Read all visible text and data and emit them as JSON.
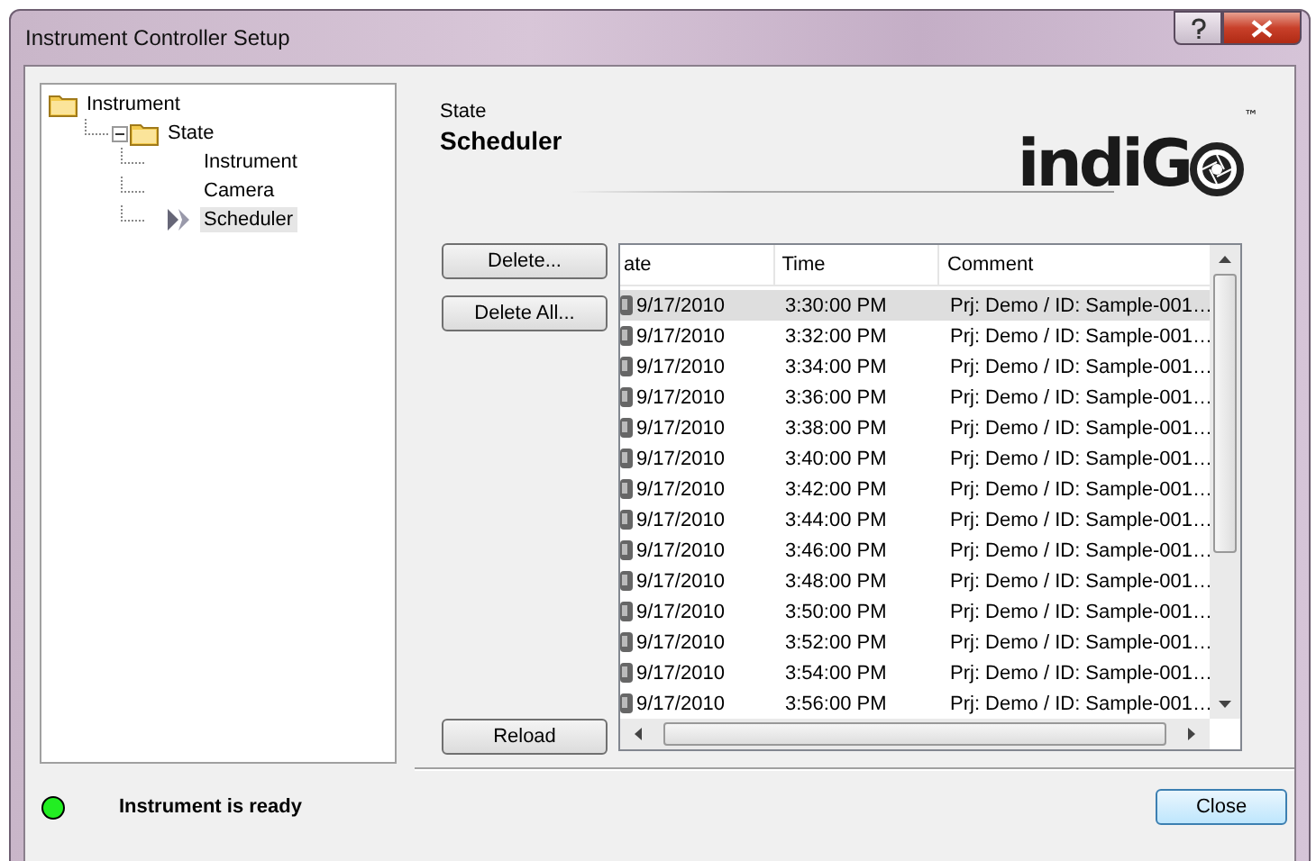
{
  "window": {
    "title": "Instrument Controller Setup"
  },
  "tree": [
    {
      "label": "Instrument",
      "kind": "folder",
      "selected": false,
      "children": [
        {
          "label": "State",
          "kind": "folder",
          "expanded": true,
          "selected": false,
          "children": [
            {
              "label": "Instrument",
              "kind": "leaf",
              "selected": false
            },
            {
              "label": "Camera",
              "kind": "leaf",
              "selected": false
            },
            {
              "label": "Scheduler",
              "kind": "leaf",
              "selected": true
            }
          ]
        }
      ]
    }
  ],
  "header": {
    "category": "State",
    "title": "Scheduler"
  },
  "logo": {
    "text": "indiG",
    "mark": "™"
  },
  "buttons": {
    "delete": "Delete...",
    "delete_all": "Delete All...",
    "reload": "Reload"
  },
  "table": {
    "columns": [
      "ate",
      "Time",
      "Comment"
    ],
    "rows": [
      {
        "date": "9/17/2010",
        "time": "3:30:00 PM",
        "comment": "Prj: Demo / ID: Sample-001…",
        "selected": true
      },
      {
        "date": "9/17/2010",
        "time": "3:32:00 PM",
        "comment": "Prj: Demo / ID: Sample-001…",
        "selected": false
      },
      {
        "date": "9/17/2010",
        "time": "3:34:00 PM",
        "comment": "Prj: Demo / ID: Sample-001…",
        "selected": false
      },
      {
        "date": "9/17/2010",
        "time": "3:36:00 PM",
        "comment": "Prj: Demo / ID: Sample-001…",
        "selected": false
      },
      {
        "date": "9/17/2010",
        "time": "3:38:00 PM",
        "comment": "Prj: Demo / ID: Sample-001…",
        "selected": false
      },
      {
        "date": "9/17/2010",
        "time": "3:40:00 PM",
        "comment": "Prj: Demo / ID: Sample-001…",
        "selected": false
      },
      {
        "date": "9/17/2010",
        "time": "3:42:00 PM",
        "comment": "Prj: Demo / ID: Sample-001…",
        "selected": false
      },
      {
        "date": "9/17/2010",
        "time": "3:44:00 PM",
        "comment": "Prj: Demo / ID: Sample-001…",
        "selected": false
      },
      {
        "date": "9/17/2010",
        "time": "3:46:00 PM",
        "comment": "Prj: Demo / ID: Sample-001…",
        "selected": false
      },
      {
        "date": "9/17/2010",
        "time": "3:48:00 PM",
        "comment": "Prj: Demo / ID: Sample-001…",
        "selected": false
      },
      {
        "date": "9/17/2010",
        "time": "3:50:00 PM",
        "comment": "Prj: Demo / ID: Sample-001…",
        "selected": false
      },
      {
        "date": "9/17/2010",
        "time": "3:52:00 PM",
        "comment": "Prj: Demo / ID: Sample-001…",
        "selected": false
      },
      {
        "date": "9/17/2010",
        "time": "3:54:00 PM",
        "comment": "Prj: Demo / ID: Sample-001…",
        "selected": false
      },
      {
        "date": "9/17/2010",
        "time": "3:56:00 PM",
        "comment": "Prj: Demo / ID: Sample-001…",
        "selected": false
      }
    ]
  },
  "status": {
    "text": "Instrument is ready",
    "color": "#22ee22"
  },
  "close_button": "Close"
}
